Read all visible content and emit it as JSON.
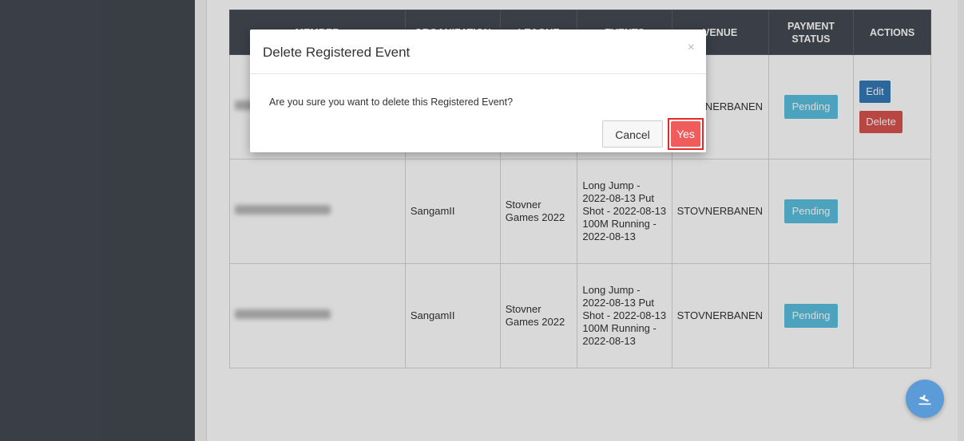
{
  "table": {
    "headers": [
      "MEMBER",
      "ORGANIZATION",
      "LEAGUE",
      "EVENTS",
      "VENUE",
      "PAYMENT STATUS",
      "ACTIONS"
    ],
    "rows": [
      {
        "organization": "",
        "league": "",
        "events": "",
        "venue": "STOVNERBANEN",
        "payment_status": "Pending"
      },
      {
        "organization": "SangamII",
        "league": "Stovner Games 2022",
        "events": "Long Jump - 2022-08-13 Put Shot - 2022-08-13 100M Running - 2022-08-13",
        "venue": "STOVNERBANEN",
        "payment_status": "Pending"
      },
      {
        "organization": "SangamII",
        "league": "Stovner Games 2022",
        "events": "Long Jump - 2022-08-13 Put Shot - 2022-08-13 100M Running - 2022-08-13",
        "venue": "STOVNERBANEN",
        "payment_status": "Pending"
      }
    ],
    "actions": {
      "edit": "Edit",
      "delete": "Delete"
    }
  },
  "modal": {
    "title": "Delete Registered Event",
    "close": "×",
    "message": "Are you sure you want to delete this Registered Event?",
    "cancel": "Cancel",
    "confirm": "Yes"
  },
  "fab": {
    "icon": "flight-land-icon"
  },
  "colors": {
    "sidebar": "#444952",
    "table_header": "#454a54",
    "pending": "#5bc0de",
    "edit": "#337ab7",
    "delete": "#d9534f",
    "yes": "#f05c5c",
    "fab": "#5b9bd8"
  }
}
